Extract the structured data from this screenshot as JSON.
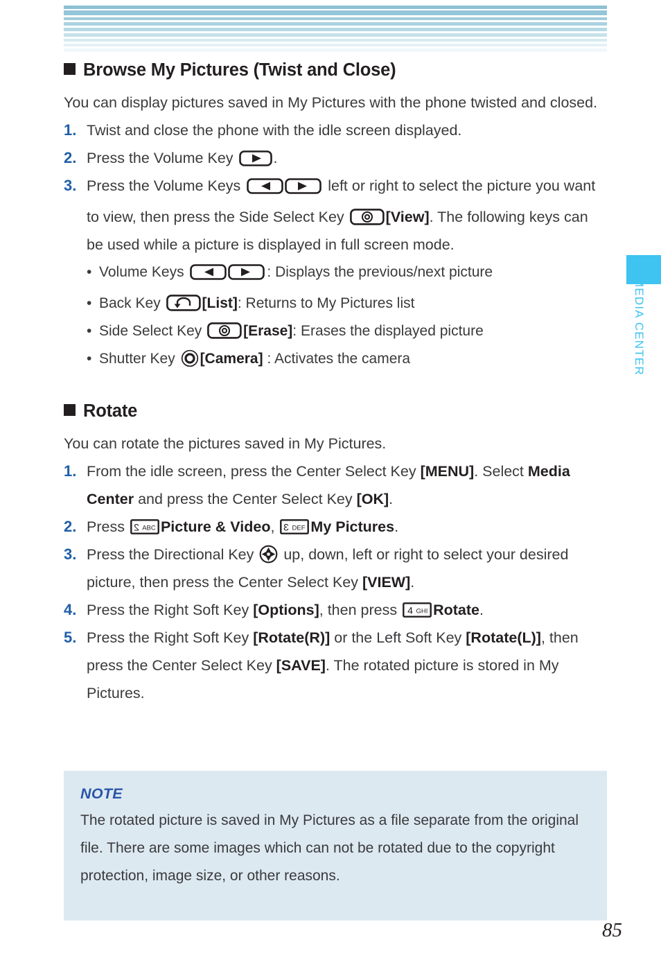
{
  "page": {
    "number": "85",
    "side_tab_label": "MEDIA CENTER",
    "accent_color": "#3fc3f0",
    "step_number_color": "#1f5fa6",
    "note_bg_color": "#dde9f1",
    "note_title_color": "#2a56a8"
  },
  "sections": [
    {
      "heading": "Browse My Pictures (Twist and Close)",
      "intro": "You can display pictures saved in My Pictures with the phone twisted and closed.",
      "steps": [
        {
          "num": "1.",
          "a": "Twist and close the phone with the idle screen displayed."
        },
        {
          "num": "2.",
          "a": "Press the Volume Key ",
          "icon": "volume-key-right",
          "b": "."
        },
        {
          "num": "3.",
          "a": "Press the Volume Keys ",
          "icon": "volume-keys-left-right",
          "b": " left or right to select the picture you want to view, then press the Side Select Key ",
          "icon2": "side-select-key",
          "bold": "[View]",
          "c": ". The following keys can be used while a picture is displayed in full screen mode."
        }
      ],
      "keylist": [
        {
          "dot": "•",
          "label": "Volume Keys ",
          "icon": "volume-keys-left-right",
          "desc": ": Displays the previous/next picture"
        },
        {
          "dot": "•",
          "label": "Back Key ",
          "icon": "back-key",
          "bold": "[List]",
          "desc": ": Returns to My Pictures list"
        },
        {
          "dot": "•",
          "label": "Side Select Key ",
          "icon": "side-select-key",
          "bold": "[Erase]",
          "desc": ": Erases the displayed picture"
        },
        {
          "dot": "•",
          "label": "Shutter Key ",
          "icon": "shutter-key",
          "bold": "[Camera]",
          "desc": " : Activates the camera"
        }
      ]
    },
    {
      "heading": "Rotate",
      "intro": "You can rotate the pictures saved in My Pictures.",
      "steps": [
        {
          "num": "1.",
          "a": "From the idle screen, press the Center Select Key ",
          "bold": "[MENU]",
          "b": ". Select ",
          "bold2": "Media Center",
          "c": " and press the Center Select Key ",
          "bold3": "[OK]",
          "d": "."
        },
        {
          "num": "2.",
          "a": "Press ",
          "icon": "keypad-2-abc",
          "bold": "Picture & Video",
          "b": ", ",
          "icon2": "keypad-3-def",
          "bold2": "My Pictures",
          "c": "."
        },
        {
          "num": "3.",
          "a": "Press the Directional Key ",
          "icon": "directional-key",
          "b": " up, down, left or right to select your desired picture, then press the Center Select Key ",
          "bold": "[VIEW]",
          "c": "."
        },
        {
          "num": "4.",
          "a": "Press the Right Soft Key ",
          "bold": "[Options]",
          "b": ", then press ",
          "icon": "keypad-4-ghi",
          "bold2": "Rotate",
          "c": "."
        },
        {
          "num": "5.",
          "a": "Press the Right Soft Key ",
          "bold": "[Rotate(R)]",
          "b": " or the Left Soft Key ",
          "bold2": "[Rotate(L)]",
          "c": ", then press the Center Select Key ",
          "bold3": "[SAVE]",
          "d": ". The rotated picture is stored in My Pictures."
        }
      ]
    }
  ],
  "note": {
    "title": "NOTE",
    "body": "The rotated picture is saved in My Pictures as a file separate from the original file. There are some images which can not be rotated due to the copyright protection, image size, or other reasons."
  },
  "keypad_icons": {
    "keypad-2-abc": {
      "digit": "2",
      "letters": "ABC"
    },
    "keypad-3-def": {
      "digit": "3",
      "letters": "DEF"
    },
    "keypad-4-ghi": {
      "digit": "4",
      "letters": "GHI"
    }
  }
}
